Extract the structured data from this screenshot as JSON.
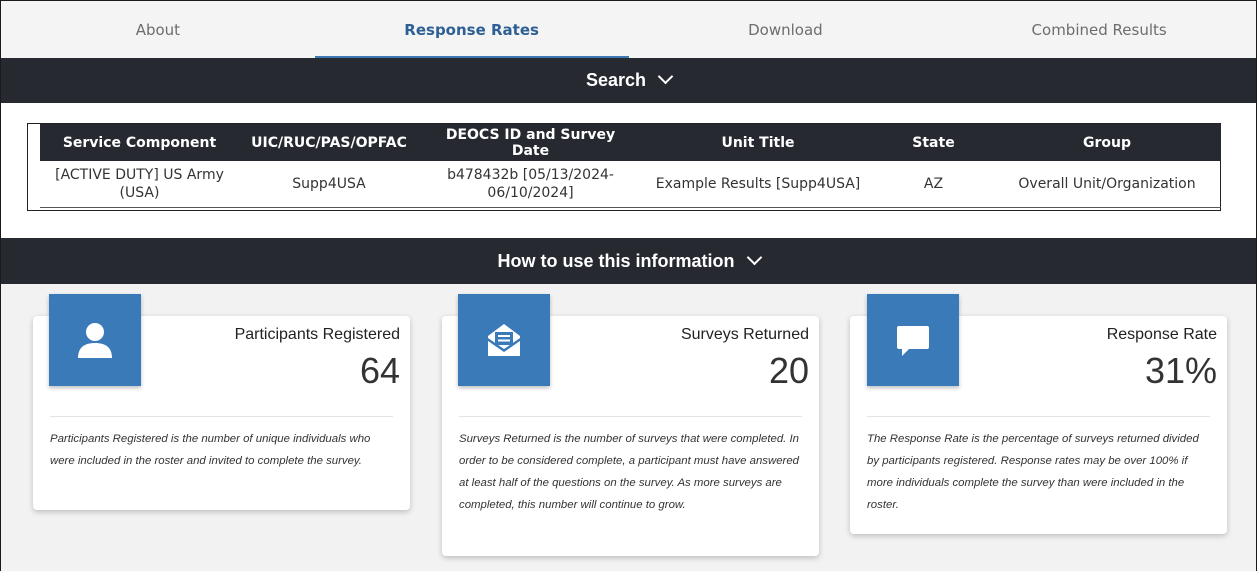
{
  "tabs": [
    {
      "label": "About",
      "active": false
    },
    {
      "label": "Response Rates",
      "active": true
    },
    {
      "label": "Download",
      "active": false
    },
    {
      "label": "Combined Results",
      "active": false
    }
  ],
  "search_bar": {
    "label": "Search"
  },
  "howto_bar": {
    "label": "How to use this information"
  },
  "table": {
    "headers": [
      "Service Component",
      "UIC/RUC/PAS/OPFAC",
      "DEOCS ID and Survey Date",
      "Unit Title",
      "State",
      "Group"
    ],
    "row": [
      "[ACTIVE DUTY] US Army (USA)",
      "Supp4USA",
      "b478432b [05/13/2024-06/10/2024]",
      "Example Results [Supp4USA]",
      "AZ",
      "Overall Unit/Organization"
    ]
  },
  "cards": [
    {
      "icon": "person-icon",
      "title": "Participants Registered",
      "value": "64",
      "description": "Participants Registered is the number of unique individuals who were included in the roster and invited to complete the survey."
    },
    {
      "icon": "envelope-icon",
      "title": "Surveys Returned",
      "value": "20",
      "description": "Surveys Returned is the number of surveys that were completed. In order to be considered complete, a participant must have answered at least half of the questions on the survey. As more surveys are completed, this number will continue to grow."
    },
    {
      "icon": "chat-bubble-icon",
      "title": "Response Rate",
      "value": "31%",
      "description": "The Response Rate is the percentage of surveys returned divided by participants registered. Response rates may be over 100% if more individuals complete the survey than were included in the roster."
    }
  ],
  "colors": {
    "accent": "#3a7ab8",
    "dark_bar": "#262a30",
    "active_tab": "#2e5f94"
  }
}
